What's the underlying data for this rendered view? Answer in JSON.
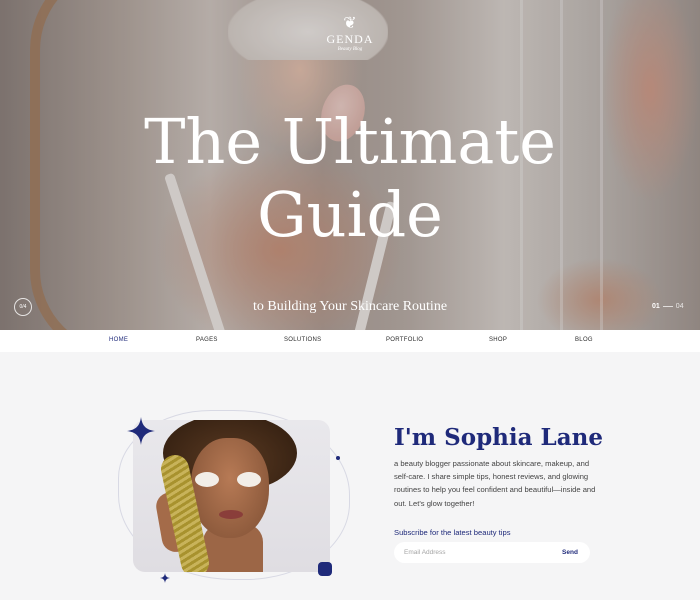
{
  "brand": {
    "name": "GENDA",
    "tagline": "Beauty Blog"
  },
  "hero": {
    "title_line1": "The Ultimate",
    "title_line2": "Guide",
    "subtitle": "to Building Your Skincare Routine",
    "slider": {
      "ring_label": "0/4",
      "current": "01",
      "total": "04"
    }
  },
  "nav": {
    "items": [
      {
        "label": "HOME"
      },
      {
        "label": "PAGES"
      },
      {
        "label": "SOLUTIONS"
      },
      {
        "label": "PORTFOLIO"
      },
      {
        "label": "SHOP"
      },
      {
        "label": "BLOG"
      }
    ]
  },
  "about": {
    "title": "I'm Sophia Lane",
    "text": "a beauty blogger passionate about skincare, makeup, and self-care. I share simple tips, honest reviews, and glowing routines to help you feel confident and beautiful—inside and out. Let's glow together!",
    "subscribe_label": "Subscribe for the latest beauty tips",
    "email_placeholder": "Email Address",
    "email_value": "",
    "send_label": "Send"
  },
  "colors": {
    "accent": "#1f2a7a",
    "background": "#f5f5f6",
    "nav_bg": "#ffffff"
  }
}
